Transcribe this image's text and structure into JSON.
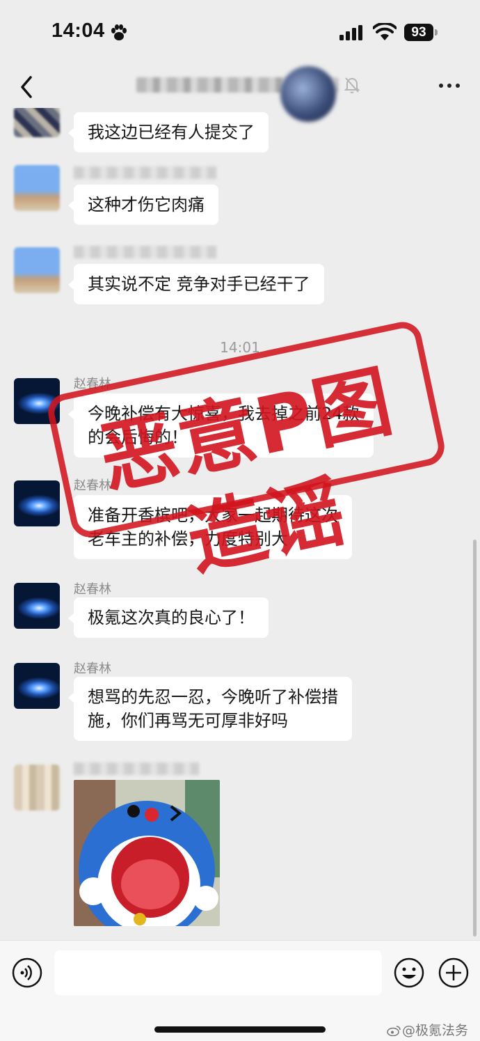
{
  "status_bar": {
    "time": "14:04",
    "battery": "93"
  },
  "messages": [
    {
      "text": "我这边已经有人提交了"
    },
    {
      "text": "这种才伤它肉痛"
    },
    {
      "text": "其实说不定 竞争对手已经干了"
    },
    {
      "timestamp": "14:01"
    },
    {
      "sender": "赵春林",
      "line1": "今晚补偿有大惊喜，我去掉之前24款",
      "line2": "的会后悔的！"
    },
    {
      "sender": "赵春林",
      "line1": "准备开香槟吧，大家一起期待这次",
      "line2": "老车主的补偿，力度特别大"
    },
    {
      "sender": "赵春林",
      "text": "极氪这次真的良心了！"
    },
    {
      "sender": "赵春林",
      "line1": "想骂的先忍一忍，今晚听了补偿措",
      "line2": "施，你们再骂无可厚非好吗"
    }
  ],
  "stamp": {
    "text": "恶意P图造谣",
    "color": "#d2141e"
  },
  "watermark": {
    "text": "@极氪法务部"
  },
  "colors": {
    "background": "#ededed",
    "bubble": "#ffffff",
    "stamp_red": "#d2141e"
  }
}
